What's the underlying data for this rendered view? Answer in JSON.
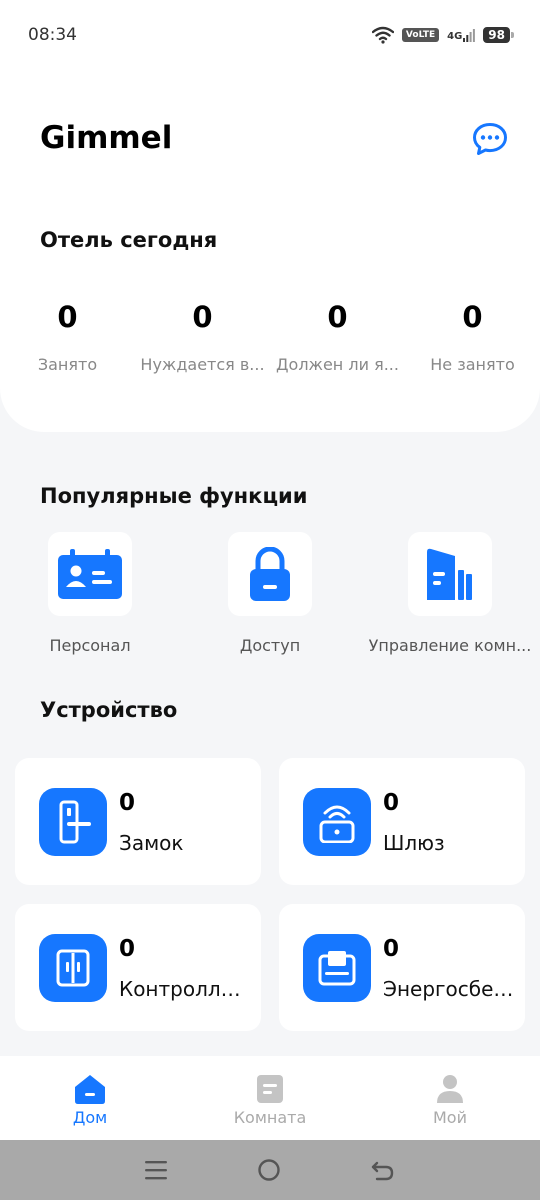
{
  "status_bar": {
    "time": "08:34",
    "volte": "VoLTE",
    "network": "4G",
    "battery": "98"
  },
  "header": {
    "title": "Gimmel",
    "chat_icon": "chat-bubble-icon"
  },
  "hotel_today": {
    "title": "Отель сегодня",
    "stats": [
      {
        "value": "0",
        "label": "Занято"
      },
      {
        "value": "0",
        "label": "Нуждается в..."
      },
      {
        "value": "0",
        "label": "Должен ли я..."
      },
      {
        "value": "0",
        "label": "Не занято"
      }
    ]
  },
  "popular": {
    "title": "Популярные функции",
    "items": [
      {
        "label": "Персонал",
        "icon": "id-card-icon"
      },
      {
        "label": "Доступ",
        "icon": "padlock-icon"
      },
      {
        "label": "Управление комн...",
        "icon": "building-icon"
      }
    ]
  },
  "devices": {
    "title": "Устройство",
    "items": [
      {
        "count": "0",
        "name": "Замок",
        "icon": "door-lock-icon"
      },
      {
        "count": "0",
        "name": "Шлюз",
        "icon": "gateway-icon"
      },
      {
        "count": "0",
        "name": "Контролле...",
        "icon": "controller-icon"
      },
      {
        "count": "0",
        "name": "Энергосбер...",
        "icon": "energy-saver-icon"
      }
    ]
  },
  "tabs": [
    {
      "label": "Дом",
      "icon": "home-icon",
      "active": true
    },
    {
      "label": "Комната",
      "icon": "room-icon",
      "active": false
    },
    {
      "label": "Мой",
      "icon": "profile-icon",
      "active": false
    }
  ],
  "colors": {
    "accent": "#1677ff",
    "background": "#f5f6f8",
    "muted": "#888888"
  }
}
